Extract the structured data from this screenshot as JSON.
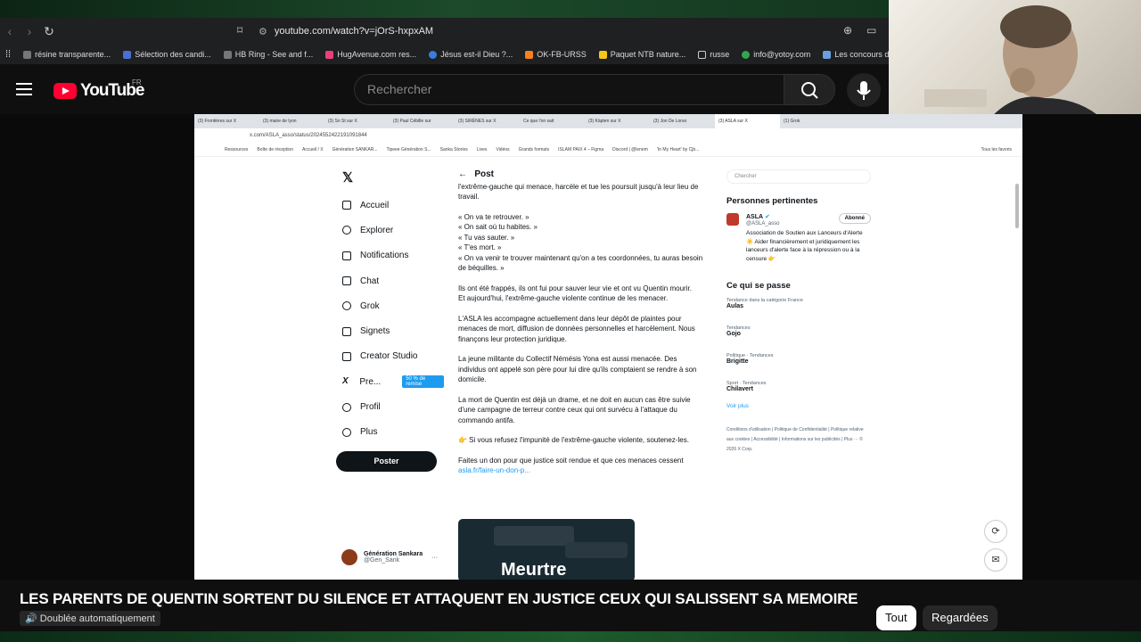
{
  "browser": {
    "url": "youtube.com/watch?v=jOrS-hxpxAM",
    "bookmarks": [
      "résine transparente...",
      "Sélection des candi...",
      "HB Ring - See and f...",
      "HugAvenue.com res...",
      "Jésus est-il Dieu ?...",
      "OK-FB-URSS",
      "Paquet NTB nature...",
      "russe",
      "info@yotoy.com",
      "Les concours d'"
    ]
  },
  "youtube": {
    "logo": "YouTube",
    "country": "FR",
    "search_placeholder": "Rechercher",
    "video_title": "LES PARENTS DE QUENTIN SORTENT DU SILENCE ET ATTAQUENT EN JUSTICE CEUX QUI SALISSENT SA MEMOIRE",
    "dubbed": "Doublée automatiquement",
    "chips": [
      "Tout",
      "Regardées"
    ]
  },
  "screen": {
    "tabs": [
      "(3) Frontières sur X",
      "(3) maire de lyon",
      "(3) Sn St sur X",
      "(3) Paul Cébille sur",
      "(3) SIRÈNES sur X",
      "Ce que l'on sait",
      "(3) Käpten sur X",
      "(3) Jon De Lorso",
      "(3) ASLA sur X",
      "(1) Grok"
    ],
    "url": "x.com/ASLA_asso/status/2024552422191091844",
    "bookmarks": [
      "Ressources",
      "Boîte de réception",
      "Accueil / X",
      "Génération SANKAR...",
      "Tipeee Génération S...",
      "Sanka Stories",
      "Lives",
      "Vidéos",
      "Grands formats",
      "ISLAM PAIX 4 – Figma",
      "Discord | @lenem",
      "'In My Heart' by Cjb...",
      "Tous les favoris"
    ],
    "nav": [
      "Accueil",
      "Explorer",
      "Notifications",
      "Chat",
      "Grok",
      "Signets",
      "Creator Studio",
      "Pre...",
      "Profil",
      "Plus"
    ],
    "nav_badge": "50 % de remise",
    "post_button": "Poster",
    "account_name": "Génération Sankara",
    "account_handle": "@Gen_Sank",
    "post_header": "Post",
    "post_paragraphs": [
      "l'extrême-gauche qui menace, harcèle et tue les poursuit jusqu'à leur lieu de travail.",
      "« On va te retrouver. »\n« On sait où tu habites. »\n« Tu vas sauter. »\n« T'es mort. »\n« On va venir te trouver maintenant qu'on a tes coordonnées, tu auras besoin de béquilles. »",
      "Ils ont été frappés, ils ont fui pour sauver leur vie et ont vu Quentin mourir.\nEt aujourd'hui, l'extrême-gauche violente continue de les menacer.",
      "L'ASLA les accompagne actuellement dans leur dépôt de plaintes pour menaces de mort, diffusion de données personnelles et harcèlement. Nous finançons leur protection juridique.",
      "La jeune militante du Collectif Némésis Yona est aussi menacée. Des individus ont appelé son père pour lui dire qu'ils comptaient se rendre à son domicile.",
      "La mort de Quentin est déjà un drame, et ne doit en aucun cas être suivie d'une campagne de terreur contre ceux qui ont survécu à l'attaque du commando antifa.",
      "👉 Si vous refusez l'impunité de l'extrême-gauche violente, soutenez-les.",
      "Faites un don pour que justice soit rendue et que ces menaces cessent"
    ],
    "post_link": "asla.fr/faire-un-don-p...",
    "media_text": "Meurtre",
    "right_search": "Chercher",
    "relevant_title": "Personnes pertinentes",
    "relevant_name": "ASLA",
    "relevant_handle": "@ASLA_asso",
    "relevant_follow": "Abonné",
    "relevant_bio": "Association de Soutien aux Lanceurs d'Alerte ☀️ Aider financièrement et juridiquement les lanceurs d'alerte face à la répression ou à la censure 👉",
    "trending_title": "Ce qui se passe",
    "trends": [
      {
        "cat": "Tendance dans la catégorie France",
        "name": "Aulas"
      },
      {
        "cat": "Tendances",
        "name": "Gojo"
      },
      {
        "cat": "Politique · Tendances",
        "name": "Brigitte"
      },
      {
        "cat": "Sport · Tendances",
        "name": "Chilavert"
      }
    ],
    "see_more": "Voir plus",
    "footer": "Conditions d'utilisation | Politique de Confidentialité | Politique relative aux cookies | Accessibilité | Informations sur les publicités | Plus ··· © 2026 X Corp."
  }
}
